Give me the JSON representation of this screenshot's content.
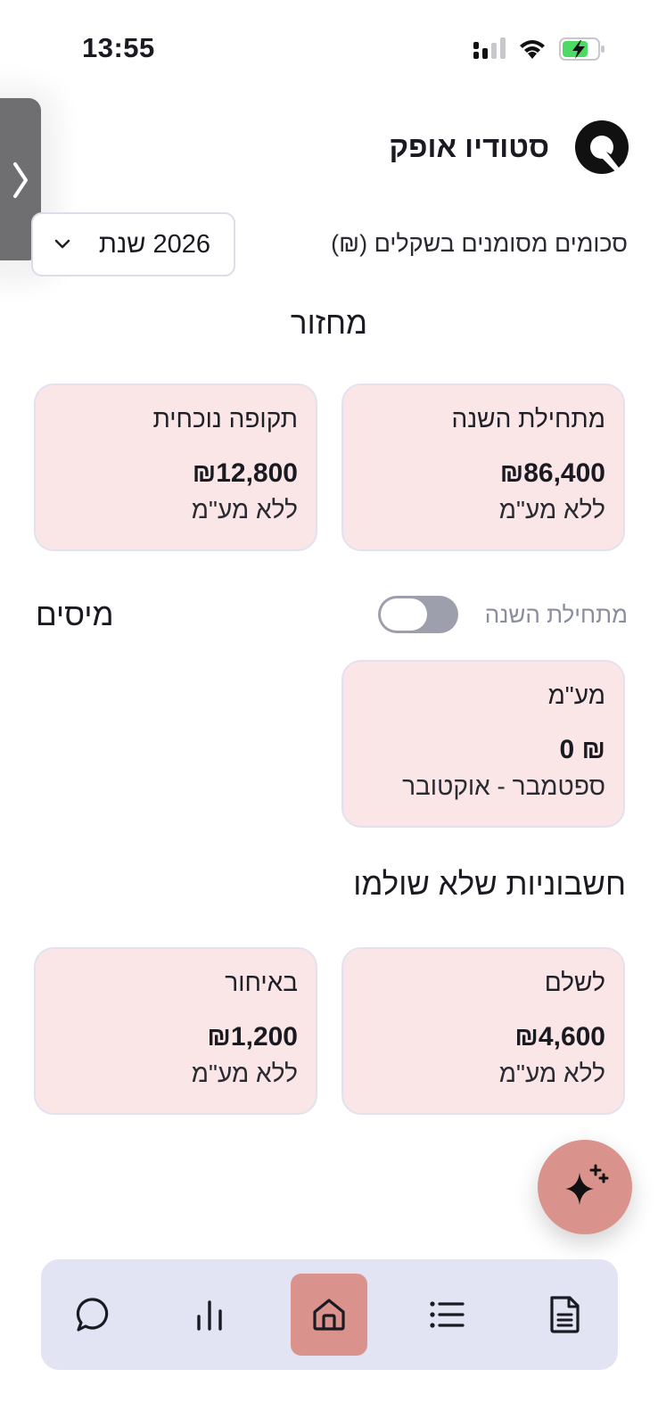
{
  "status_bar": {
    "time": "13:55",
    "battery_state": "charging",
    "battery_color": "#4cd964"
  },
  "app": {
    "title": "סטודיו אופק",
    "logo_icon": "studio-logo-icon"
  },
  "filters": {
    "amounts_note": "סכומים מסומנים בשקלים (₪)",
    "year_select_label": "2026 שנת"
  },
  "revenue": {
    "title": "מחזור",
    "cards": [
      {
        "label": "מתחילת השנה",
        "amount": "₪86,400",
        "note": "ללא מע\"מ"
      },
      {
        "label": "תקופה נוכחית",
        "amount": "₪12,800",
        "note": "ללא מע\"מ"
      }
    ]
  },
  "taxes": {
    "title": "מיסים",
    "toggle_label": "מתחילת השנה",
    "toggle_on": false,
    "vat_card": {
      "label": "מע\"מ",
      "amount": "₪ 0",
      "period": "ספטמבר - אוקטובר"
    }
  },
  "unpaid": {
    "title": "חשבוניות שלא שולמו",
    "cards": [
      {
        "label": "לשלם",
        "amount": "₪4,600",
        "note": "ללא מע\"מ"
      },
      {
        "label": "באיחור",
        "amount": "₪1,200",
        "note": "ללא מע\"מ"
      }
    ]
  },
  "fab": {
    "icon": "sparkles-icon"
  },
  "bottom_nav": {
    "items": [
      {
        "icon": "chat-icon",
        "active": false
      },
      {
        "icon": "bar-chart-icon",
        "active": false
      },
      {
        "icon": "home-icon",
        "active": true
      },
      {
        "icon": "list-icon",
        "active": false
      },
      {
        "icon": "document-icon",
        "active": false
      }
    ]
  },
  "colors": {
    "card_bg": "#fae6e6",
    "accent": "#d9928c",
    "nav_bg": "#e3e4f3",
    "toggle_off": "#9d9fad"
  }
}
